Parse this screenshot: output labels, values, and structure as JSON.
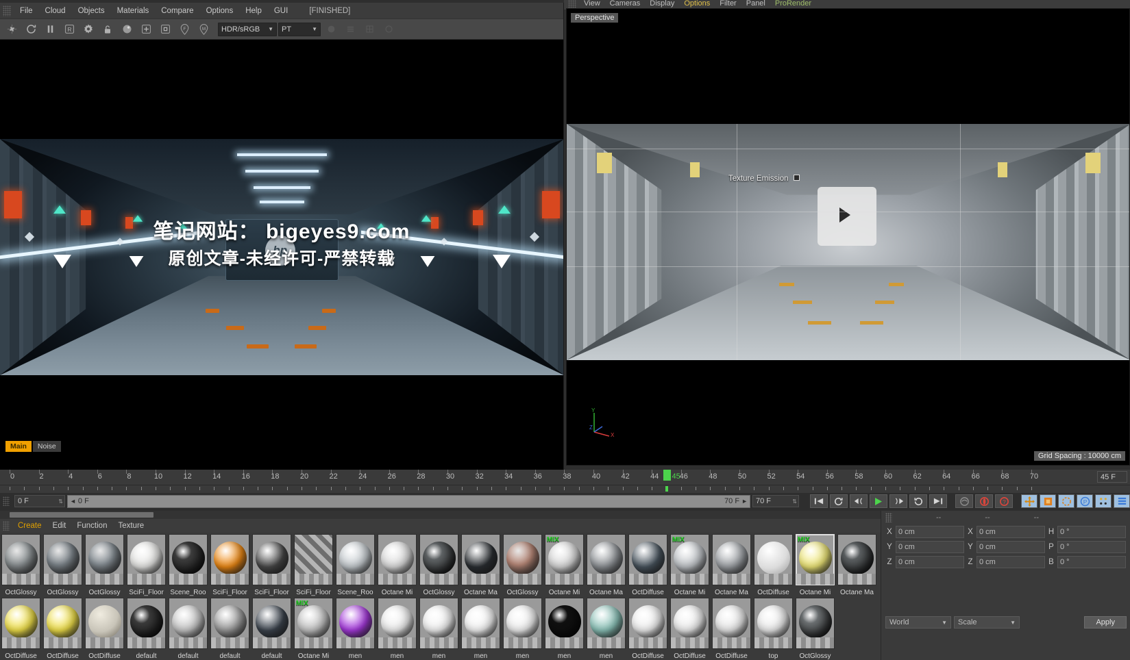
{
  "octane_window": {
    "menus": [
      "File",
      "Cloud",
      "Objects",
      "Materials",
      "Compare",
      "Options",
      "Help",
      "GUI"
    ],
    "status": "[FINISHED]",
    "toolbar": {
      "icons": [
        "restart-render-icon",
        "refresh-icon",
        "pause-icon",
        "region-render-icon",
        "settings-gear-icon",
        "lock-icon",
        "sphere-preview-icon",
        "add-icon",
        "subregion-icon",
        "focus-pin-icon",
        "material-pin-icon"
      ],
      "colorspace": "HDR/sRGB",
      "kernel": "PT"
    },
    "tabs": [
      {
        "label": "Main",
        "active": true
      },
      {
        "label": "Noise",
        "active": false
      }
    ],
    "watermark_line1": "笔记网站： bigeyes9.com",
    "watermark_line2": "原创文章-未经许可-严禁转载",
    "render_logo": "hp"
  },
  "c4d": {
    "top_menus": [
      "View",
      "Cameras",
      "Display",
      "Options",
      "Filter",
      "Panel",
      "ProRender"
    ],
    "viewport_label": "Perspective",
    "grid_spacing": "Grid Spacing : 10000 cm",
    "texture_emission_label": "Texture Emission",
    "axis": {
      "x": "X",
      "y": "Y",
      "z": "Z"
    }
  },
  "timeline": {
    "ticks": [
      0,
      2,
      4,
      6,
      8,
      10,
      12,
      14,
      16,
      18,
      20,
      22,
      24,
      26,
      28,
      30,
      32,
      34,
      36,
      38,
      40,
      42,
      44,
      46,
      48,
      50,
      52,
      54,
      56,
      58,
      60,
      62,
      64,
      66,
      68,
      70
    ],
    "playhead_frame": 45,
    "playhead_label": "45",
    "current_frame_display": "45 F",
    "start_field": "0 F",
    "range_start": "0 F",
    "range_end": "70 F",
    "end_field": "70 F",
    "transport": [
      {
        "name": "go-to-start-button",
        "glyph": "⏮"
      },
      {
        "name": "previous-key-button",
        "glyph": "↺"
      },
      {
        "name": "step-back-button",
        "glyph": "◂("
      },
      {
        "name": "play-button",
        "glyph": "▶"
      },
      {
        "name": "step-forward-button",
        "glyph": ")▸"
      },
      {
        "name": "next-key-button",
        "glyph": "↻"
      },
      {
        "name": "go-to-end-button",
        "glyph": "⏭"
      }
    ],
    "record_buttons": [
      {
        "name": "autokey-icon",
        "glyph": "◎",
        "color": "#888888"
      },
      {
        "name": "record-active-objects-icon",
        "glyph": "◉",
        "color": "#d8453c"
      },
      {
        "name": "record-help-icon",
        "glyph": "?",
        "color": "#d8453c"
      }
    ],
    "tool_buttons": [
      {
        "name": "move-tool-icon",
        "glyph": "✥",
        "color": "#e8a030"
      },
      {
        "name": "scale-tool-icon",
        "glyph": "▣",
        "color": "#e08020"
      },
      {
        "name": "rotate-tool-icon",
        "glyph": "◌",
        "color": "#d8862c"
      },
      {
        "name": "parametric-tool-icon",
        "glyph": "P",
        "color": "#3a7ad8"
      },
      {
        "name": "axis-points-icon",
        "glyph": "⁙",
        "color": "#d8a83c"
      },
      {
        "name": "layout-icon",
        "glyph": "☰",
        "color": "#3a7ad8"
      }
    ]
  },
  "material_manager": {
    "menus": [
      "Create",
      "Edit",
      "Function",
      "Texture"
    ],
    "active_menu": "Create",
    "materials": [
      {
        "name": "OctGlossy",
        "color": "#8e9496",
        "type": "textured",
        "mix": false,
        "selected": false
      },
      {
        "name": "OctGlossy",
        "color": "#7e868c",
        "type": "textured",
        "mix": false,
        "selected": false
      },
      {
        "name": "OctGlossy",
        "color": "#868e94",
        "type": "textured",
        "mix": false,
        "selected": false
      },
      {
        "name": "SciFi_Floor",
        "color": "#e6e6e4",
        "type": "plain",
        "mix": false,
        "selected": false
      },
      {
        "name": "Scene_Roo",
        "color": "#3c3c3c",
        "type": "noise",
        "mix": false,
        "selected": false
      },
      {
        "name": "SciFi_Floor",
        "color": "#ef8a14",
        "type": "plain",
        "mix": false,
        "selected": false
      },
      {
        "name": "SciFi_Floor",
        "color": "#4a4a4a",
        "type": "plain",
        "mix": false,
        "selected": false
      },
      {
        "name": "SciFi_Floor",
        "color": "#b4b4b4",
        "type": "stripes",
        "mix": false,
        "selected": false
      },
      {
        "name": "Scene_Roo",
        "color": "#c6ccd0",
        "type": "plain",
        "mix": false,
        "selected": false
      },
      {
        "name": "Octane Mi",
        "color": "#dcdcdc",
        "type": "plain",
        "mix": false,
        "selected": false
      },
      {
        "name": "OctGlossy",
        "color": "#5e6264",
        "type": "noise",
        "mix": false,
        "selected": false
      },
      {
        "name": "Octane Ma",
        "color": "#2c3034",
        "type": "plain",
        "mix": false,
        "selected": false
      },
      {
        "name": "OctGlossy",
        "color": "#b88878",
        "type": "textured",
        "mix": false,
        "selected": false
      },
      {
        "name": "Octane Mi",
        "color": "#d8d8d8",
        "type": "plain",
        "mix": true,
        "selected": false
      },
      {
        "name": "Octane Ma",
        "color": "#8e9296",
        "type": "plain",
        "mix": false,
        "selected": false
      },
      {
        "name": "OctDiffuse",
        "color": "#4a5660",
        "type": "plain",
        "mix": false,
        "selected": false
      },
      {
        "name": "Octane Mi",
        "color": "#c0c4c8",
        "type": "plain",
        "mix": true,
        "selected": false
      },
      {
        "name": "Octane Ma",
        "color": "#9ea2a6",
        "type": "plain",
        "mix": false,
        "selected": false
      },
      {
        "name": "OctDiffuse",
        "color": "#dcdcdc",
        "type": "hand",
        "mix": false,
        "selected": false
      },
      {
        "name": "Octane Mi",
        "color": "#f0e878",
        "type": "plain",
        "mix": true,
        "selected": true
      },
      {
        "name": "Octane Ma",
        "color": "#5a5e60",
        "type": "noise",
        "mix": false,
        "selected": false
      },
      {
        "name": "OctDiffuse",
        "color": "#f2e24a",
        "type": "plain",
        "mix": false,
        "selected": false
      },
      {
        "name": "OctDiffuse",
        "color": "#f2e24a",
        "type": "plain",
        "mix": false,
        "selected": false
      },
      {
        "name": "OctDiffuse",
        "color": "#c8c4b8",
        "type": "text",
        "mix": false,
        "selected": false
      },
      {
        "name": "default",
        "color": "#3a3a3a",
        "type": "noise",
        "mix": false,
        "selected": false
      },
      {
        "name": "default",
        "color": "#c8c8c8",
        "type": "plain",
        "mix": false,
        "selected": false
      },
      {
        "name": "default",
        "color": "#9a9a9a",
        "type": "plain",
        "mix": false,
        "selected": false
      },
      {
        "name": "default",
        "color": "#3e4650",
        "type": "plain",
        "mix": false,
        "selected": false
      },
      {
        "name": "Octane Mi",
        "color": "#c4c4c4",
        "type": "plain",
        "mix": true,
        "selected": false
      },
      {
        "name": "men",
        "color": "#a83ae0",
        "type": "plain",
        "mix": false,
        "selected": false
      },
      {
        "name": "men",
        "color": "#eeeeee",
        "type": "plain",
        "mix": false,
        "selected": false
      },
      {
        "name": "men",
        "color": "#f2f2f2",
        "type": "plain",
        "mix": false,
        "selected": false
      },
      {
        "name": "men",
        "color": "#f4f4f4",
        "type": "plain",
        "mix": false,
        "selected": false
      },
      {
        "name": "men",
        "color": "#f0f0f0",
        "type": "plain",
        "mix": false,
        "selected": false
      },
      {
        "name": "men",
        "color": "#101010",
        "type": "noise",
        "mix": false,
        "selected": false
      },
      {
        "name": "men",
        "color": "#8cc4ba",
        "type": "plain",
        "mix": false,
        "selected": false
      },
      {
        "name": "OctDiffuse",
        "color": "#f0f0f0",
        "type": "plain",
        "mix": false,
        "selected": false
      },
      {
        "name": "OctDiffuse",
        "color": "#ededed",
        "type": "plain",
        "mix": false,
        "selected": false
      },
      {
        "name": "OctDiffuse",
        "color": "#e8e8e8",
        "type": "plain",
        "mix": false,
        "selected": false
      },
      {
        "name": "top",
        "color": "#ececec",
        "type": "plain",
        "mix": false,
        "selected": false
      },
      {
        "name": "OctGlossy",
        "color": "#6a6e70",
        "type": "noise",
        "mix": false,
        "selected": false
      }
    ]
  },
  "coordinates": {
    "header": [
      "--",
      "--",
      "--"
    ],
    "rows": [
      {
        "pos_label": "X",
        "pos_value": "0 cm",
        "size_label": "X",
        "size_value": "0 cm",
        "rot_label": "H",
        "rot_value": "0 °"
      },
      {
        "pos_label": "Y",
        "pos_value": "0 cm",
        "size_label": "Y",
        "size_value": "0 cm",
        "rot_label": "P",
        "rot_value": "0 °"
      },
      {
        "pos_label": "Z",
        "pos_value": "0 cm",
        "size_label": "Z",
        "size_value": "0 cm",
        "rot_label": "B",
        "rot_value": "0 °"
      }
    ],
    "coord_system": "World",
    "transform_mode": "Scale",
    "apply_label": "Apply"
  }
}
